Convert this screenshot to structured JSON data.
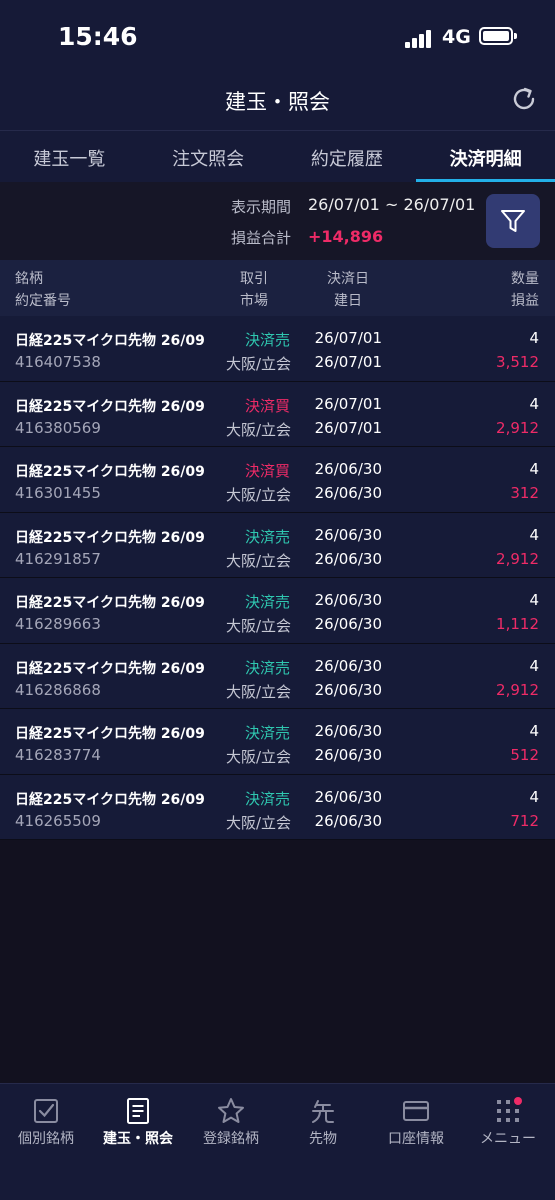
{
  "status_bar": {
    "time": "15:46",
    "network": "4G"
  },
  "header": {
    "title": "建玉・照会"
  },
  "tabs": [
    {
      "label": "建玉一覧",
      "active": false
    },
    {
      "label": "注文照会",
      "active": false
    },
    {
      "label": "約定履歴",
      "active": false
    },
    {
      "label": "決済明細",
      "active": true
    }
  ],
  "summary": {
    "period_label": "表示期間",
    "period_value": "26/07/01 ~ 26/07/01",
    "pnl_label": "損益合計",
    "pnl_value": "+14,896"
  },
  "columns": {
    "name": "銘柄",
    "order_no": "約定番号",
    "side": "取引",
    "market": "市場",
    "settle_date": "決済日",
    "open_date": "建日",
    "qty": "数量",
    "pnl": "損益"
  },
  "rows": [
    {
      "name": "日経225マイクロ先物 26/09",
      "order_no": "416407538",
      "side": "決済売",
      "side_type": "sell",
      "market": "大阪/立会",
      "settle_date": "26/07/01",
      "open_date": "26/07/01",
      "qty": "4",
      "pnl": "3,512"
    },
    {
      "name": "日経225マイクロ先物 26/09",
      "order_no": "416380569",
      "side": "決済買",
      "side_type": "buy",
      "market": "大阪/立会",
      "settle_date": "26/07/01",
      "open_date": "26/07/01",
      "qty": "4",
      "pnl": "2,912"
    },
    {
      "name": "日経225マイクロ先物 26/09",
      "order_no": "416301455",
      "side": "決済買",
      "side_type": "buy",
      "market": "大阪/立会",
      "settle_date": "26/06/30",
      "open_date": "26/06/30",
      "qty": "4",
      "pnl": "312"
    },
    {
      "name": "日経225マイクロ先物 26/09",
      "order_no": "416291857",
      "side": "決済売",
      "side_type": "sell",
      "market": "大阪/立会",
      "settle_date": "26/06/30",
      "open_date": "26/06/30",
      "qty": "4",
      "pnl": "2,912"
    },
    {
      "name": "日経225マイクロ先物 26/09",
      "order_no": "416289663",
      "side": "決済売",
      "side_type": "sell",
      "market": "大阪/立会",
      "settle_date": "26/06/30",
      "open_date": "26/06/30",
      "qty": "4",
      "pnl": "1,112"
    },
    {
      "name": "日経225マイクロ先物 26/09",
      "order_no": "416286868",
      "side": "決済売",
      "side_type": "sell",
      "market": "大阪/立会",
      "settle_date": "26/06/30",
      "open_date": "26/06/30",
      "qty": "4",
      "pnl": "2,912"
    },
    {
      "name": "日経225マイクロ先物 26/09",
      "order_no": "416283774",
      "side": "決済売",
      "side_type": "sell",
      "market": "大阪/立会",
      "settle_date": "26/06/30",
      "open_date": "26/06/30",
      "qty": "4",
      "pnl": "512"
    },
    {
      "name": "日経225マイクロ先物 26/09",
      "order_no": "416265509",
      "side": "決済売",
      "side_type": "sell",
      "market": "大阪/立会",
      "settle_date": "26/06/30",
      "open_date": "26/06/30",
      "qty": "4",
      "pnl": "712"
    }
  ],
  "bottom_nav": [
    {
      "label": "個別銘柄",
      "icon": "checkbox-icon",
      "active": false
    },
    {
      "label": "建玉・照会",
      "icon": "document-icon",
      "active": true
    },
    {
      "label": "登録銘柄",
      "icon": "star-icon",
      "active": false
    },
    {
      "label": "先物",
      "icon": "futures-icon",
      "active": false
    },
    {
      "label": "口座情報",
      "icon": "card-icon",
      "active": false
    },
    {
      "label": "メニュー",
      "icon": "menu-grid-icon",
      "active": false,
      "badge": true
    }
  ],
  "colors": {
    "accent": "#23b0e8",
    "sell": "#2fc7b0",
    "buy": "#ee2b67",
    "profit": "#ee2b67"
  }
}
